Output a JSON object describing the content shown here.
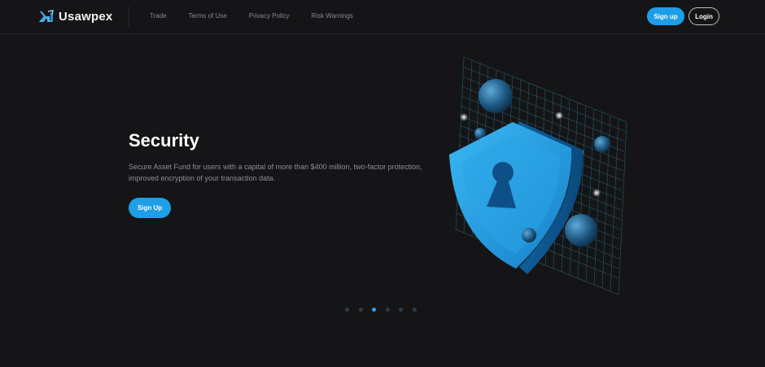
{
  "brand": {
    "name": "Usawpex"
  },
  "nav": {
    "items": [
      "Trade",
      "Terms of Use",
      "Privacy Policy",
      "Risk Warnings"
    ]
  },
  "auth": {
    "signup_label": "Sign up",
    "login_label": "Login"
  },
  "hero": {
    "title": "Security",
    "description": "Secure Asset Fund for users with a capital of more than $400 million, two-factor protection, improved encryption of your transaction data.",
    "cta_label": "Sign Up",
    "illustration_icon": "shield-keyhole-icon"
  },
  "carousel": {
    "count": 6,
    "active_index": 2
  },
  "colors": {
    "accent": "#1e9ee6",
    "background": "#151517",
    "muted_text": "#8f8f96"
  }
}
